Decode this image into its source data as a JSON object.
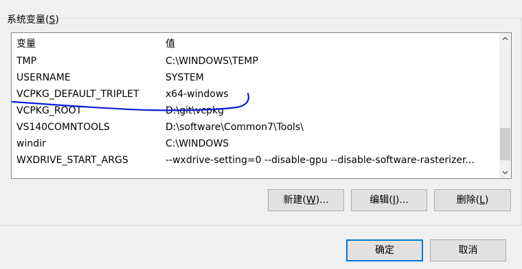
{
  "group": {
    "label_prefix": "系统变量(",
    "label_accel": "S",
    "label_suffix": ")"
  },
  "table": {
    "columns": [
      "变量",
      "值"
    ],
    "rows": [
      {
        "name": "TMP",
        "value": "C:\\WINDOWS\\TEMP"
      },
      {
        "name": "USERNAME",
        "value": "SYSTEM"
      },
      {
        "name": "VCPKG_DEFAULT_TRIPLET",
        "value": "x64-windows"
      },
      {
        "name": "VCPKG_ROOT",
        "value": "D:\\git\\vcpkg"
      },
      {
        "name": "VS140COMNTOOLS",
        "value": "D:\\software\\Common7\\Tools\\"
      },
      {
        "name": "windir",
        "value": "C:\\WINDOWS"
      },
      {
        "name": "WXDRIVE_START_ARGS",
        "value": "--wxdrive-setting=0 --disable-gpu --disable-software-rasterizer..."
      }
    ]
  },
  "scrollbar": {
    "up_icon": "triangle-up",
    "down_icon": "triangle-down"
  },
  "buttons": {
    "new": {
      "prefix": "新建(",
      "accel": "W",
      "suffix": ")..."
    },
    "edit": {
      "prefix": "编辑(",
      "accel": "I",
      "suffix": ")..."
    },
    "delete": {
      "prefix": "删除(",
      "accel": "L",
      "suffix": ")"
    },
    "ok": {
      "label": "确定"
    },
    "cancel": {
      "label": "取消"
    }
  },
  "colors": {
    "dialog_bg": "#f0f0f0",
    "list_bg": "#ffffff",
    "default_button_border": "#0078d7",
    "annotation_ink": "#0a1fd6"
  }
}
